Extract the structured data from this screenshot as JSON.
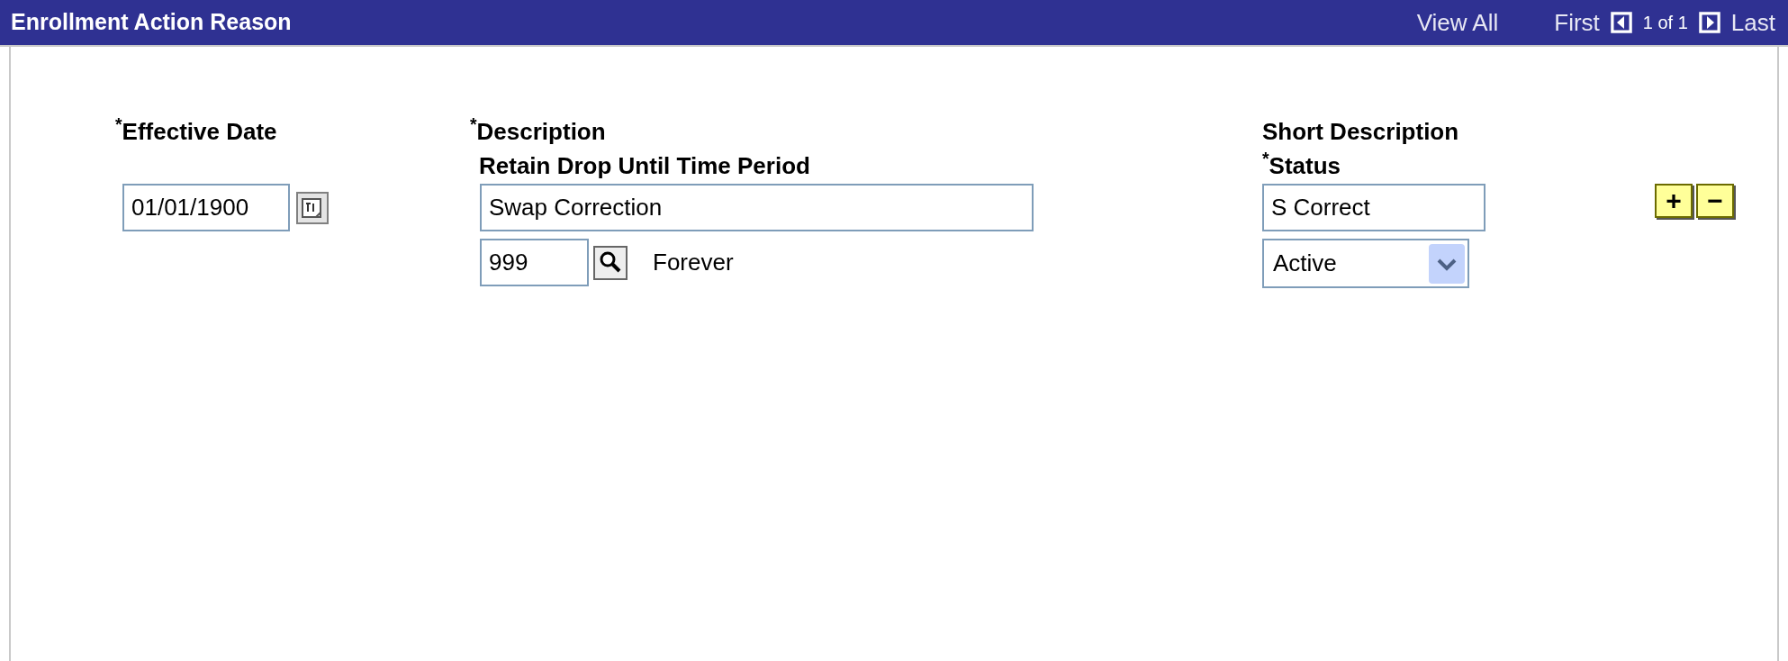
{
  "header": {
    "title": "Enrollment Action Reason",
    "view_all": "View All",
    "first": "First",
    "page": "1 of 1",
    "last": "Last"
  },
  "labels": {
    "effective_date": "$^{*}$Effective Date",
    "description": "$^{*}$Description",
    "retain_drop": "Retain Drop Until Time Period",
    "short_description": "Short Description",
    "status": "$^{*}$Status"
  },
  "fields": {
    "effective_date": "01/01/1900",
    "description": "Swap Correction",
    "retain_drop": "999",
    "retain_drop_text": "Forever",
    "short_description": "S Correct",
    "status": "Active"
  },
  "row_buttons": [
    "+",
    "−"
  ]
}
